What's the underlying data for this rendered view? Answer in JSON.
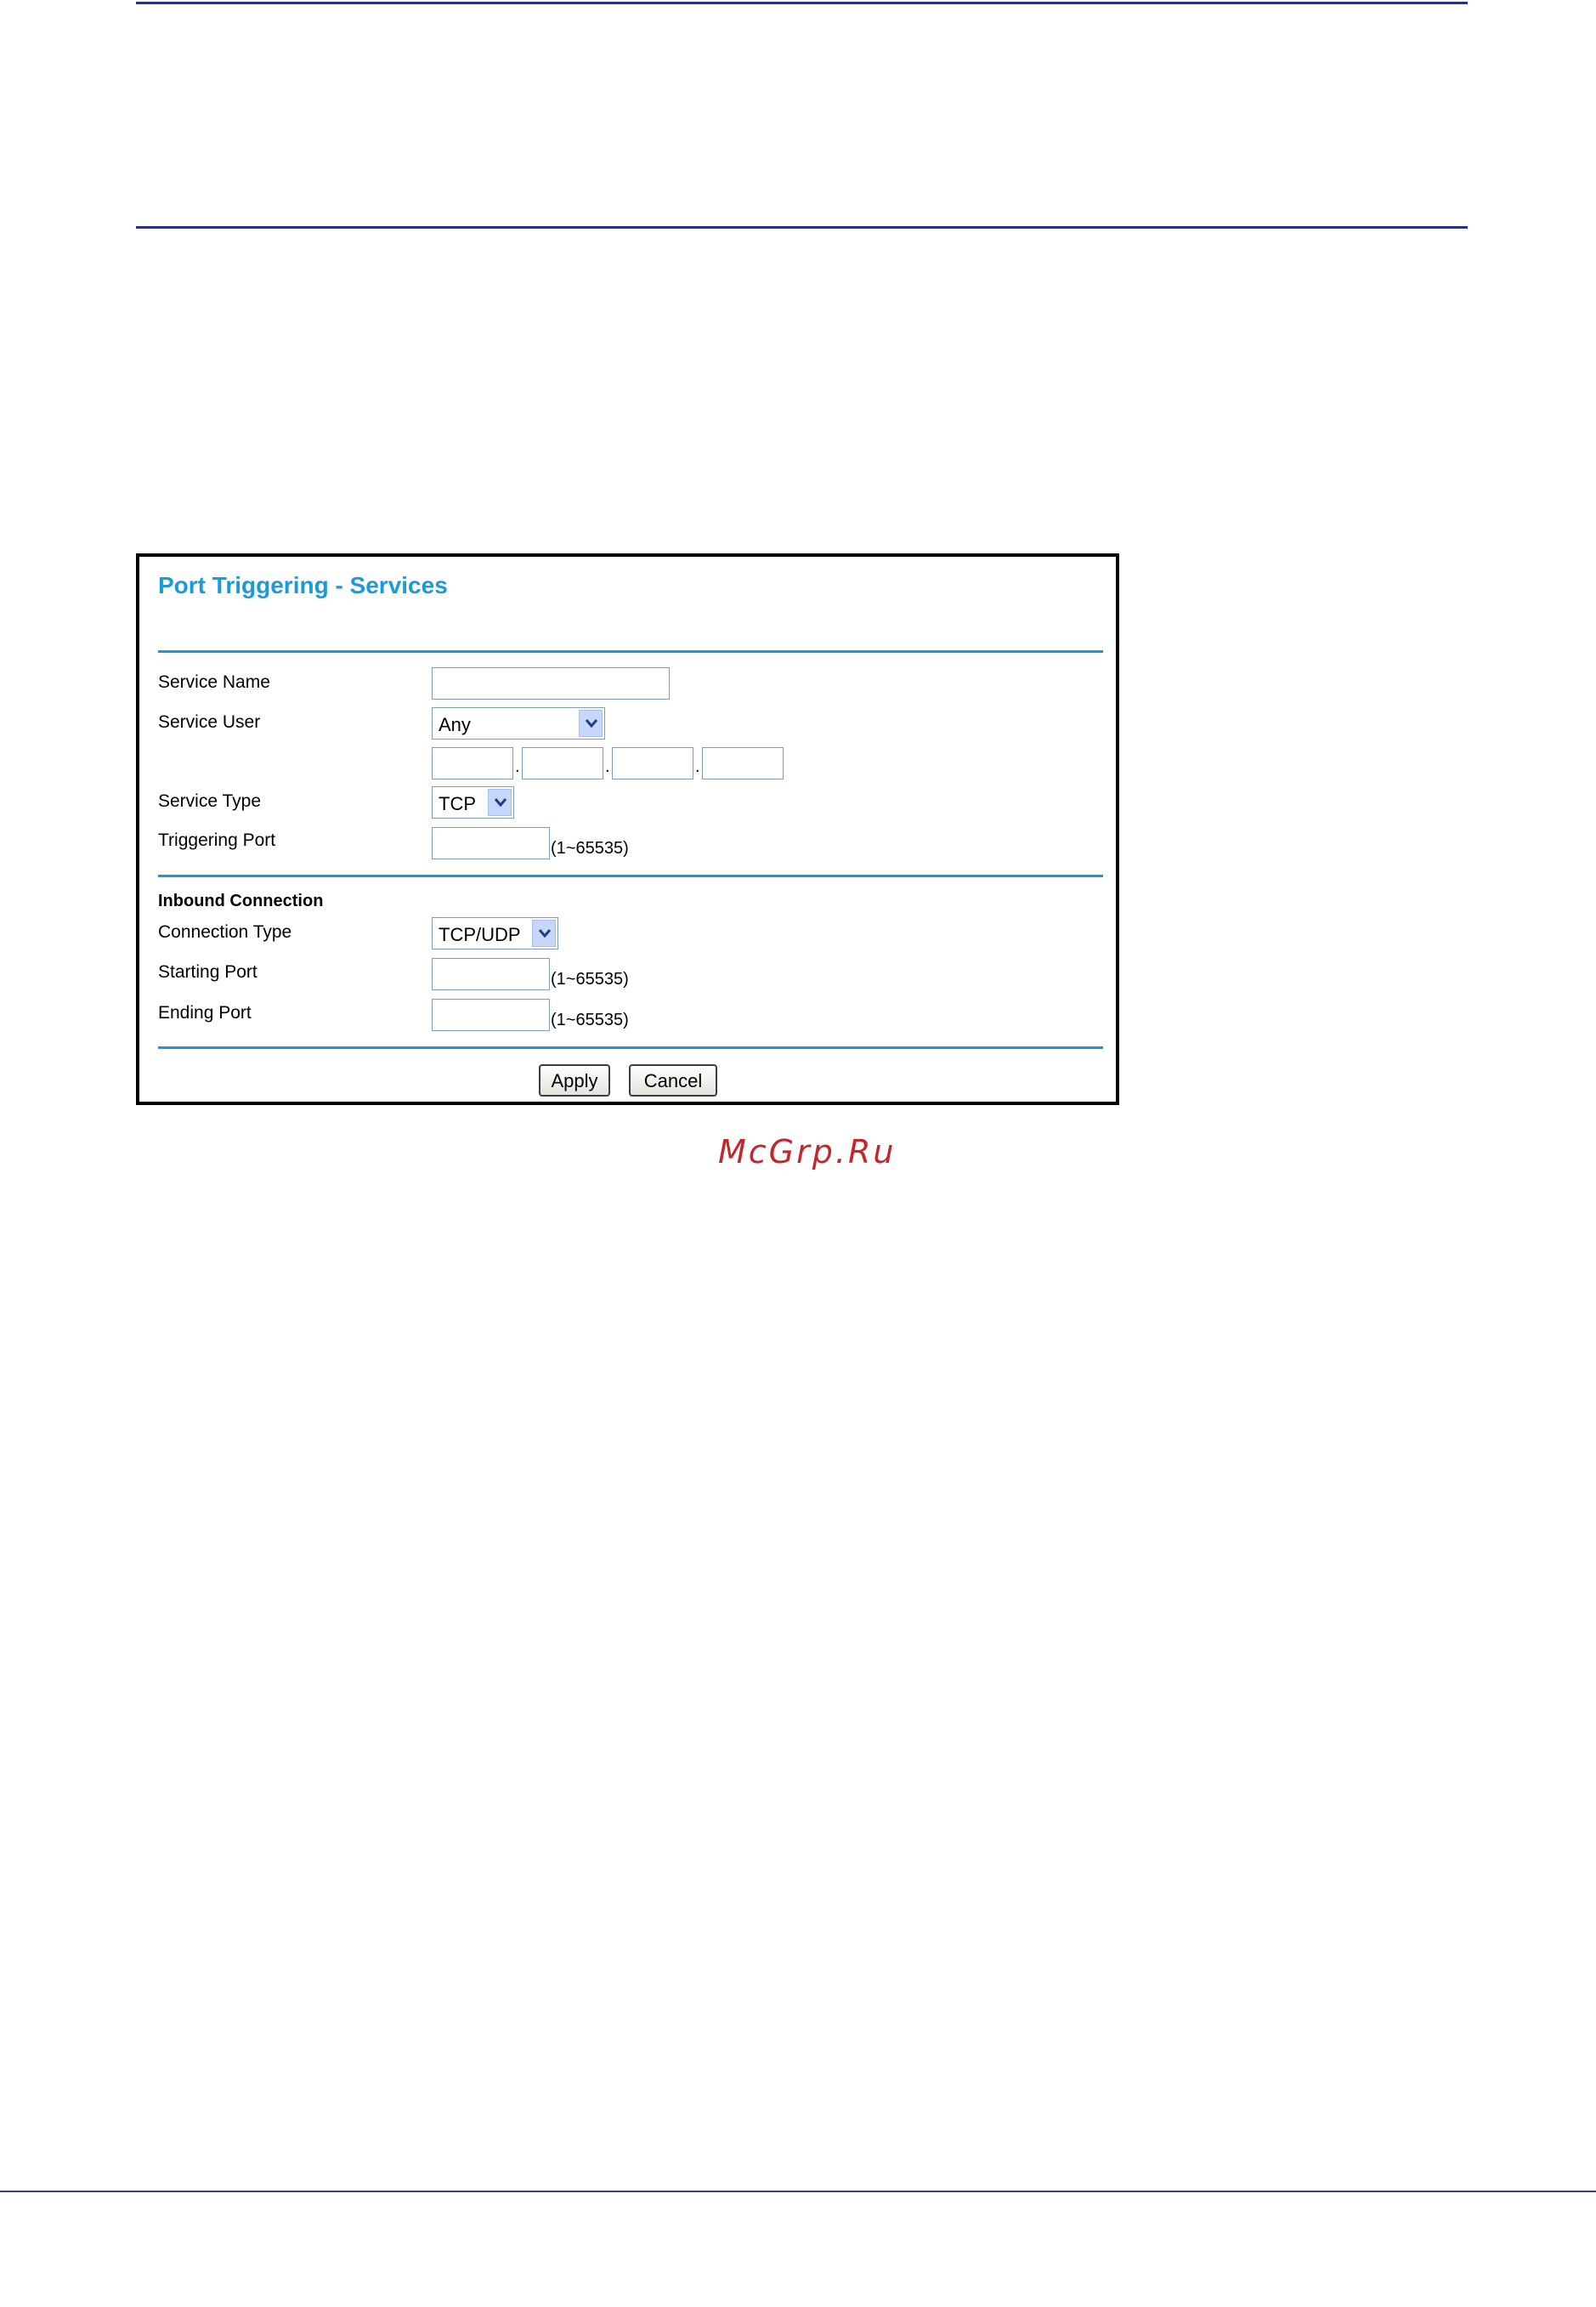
{
  "panel": {
    "title": "Port Triggering - Services",
    "fields": {
      "service_name_label": "Service Name",
      "service_name_value": "",
      "service_user_label": "Service User",
      "service_user_value": "Any",
      "service_type_label": "Service Type",
      "service_type_value": "TCP",
      "triggering_port_label": "Triggering Port",
      "triggering_port_value": "",
      "port_range_hint": "(1~65535)"
    },
    "inbound": {
      "heading": "Inbound Connection",
      "connection_type_label": "Connection Type",
      "connection_type_value": "TCP/UDP",
      "starting_port_label": "Starting Port",
      "ending_port_label": "Ending Port",
      "port_range_hint": "(1~65535)"
    },
    "ip_separator": ".",
    "buttons": {
      "apply": "Apply",
      "cancel": "Cancel"
    }
  },
  "watermark": "McGrp.Ru",
  "colors": {
    "accent": "#1a9ad6",
    "rule": "#2b2f8f",
    "watermark": "#c1272d"
  },
  "icons": {
    "dropdown": "chevron-down-icon"
  }
}
